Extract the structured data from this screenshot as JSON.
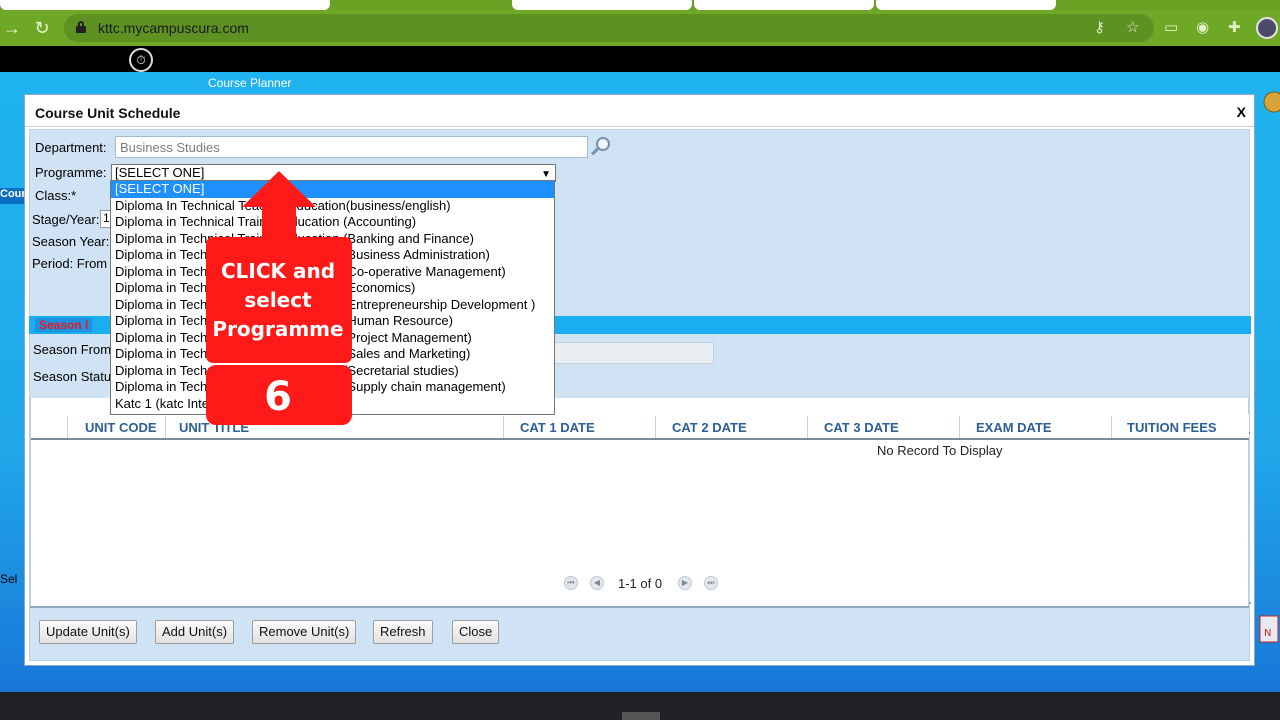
{
  "browser": {
    "url": "kttc.mycampuscura.com"
  },
  "page": {
    "title": "Course Planner",
    "left_label": "Cour",
    "left_select_text": "Sel"
  },
  "modal": {
    "title": "Course Unit Schedule",
    "close_label": "X",
    "department": {
      "label": "Department:",
      "value": "Business Studies"
    },
    "programme": {
      "label": "Programme:",
      "selected": "[SELECT ONE]",
      "options": [
        "[SELECT ONE]",
        "Diploma In Technical Teacher Education(business/english)",
        "Diploma in Technical Trainer Education (Accounting)",
        "Diploma in Technical Trainer Education (Banking and Finance)",
        "Diploma in Technical Trainer Education (Business Administration)",
        "Diploma in Technical Trainer Education (Co-operative Management)",
        "Diploma in Technical Trainer Education (Economics)",
        "Diploma in Technical Trainer Education (Entrepreneurship Development )",
        "Diploma in Technical Trainer Education (Human Resource)",
        "Diploma in Technical Trainer Education (Project Management)",
        "Diploma in Technical Trainer Education (Sales and Marketing)",
        "Diploma in Technical Trainer Education (Secretarial studies)",
        "Diploma in Technical Trainer Education (Supply chain management)",
        "Katc 1 (katc Intern)"
      ]
    },
    "class_label": "Class:*",
    "stage_label": "Stage/Year:",
    "stage_value": "1",
    "season_year_label": "Season Year:",
    "period_label": "Period: From",
    "season_tab": "Season I",
    "season_from_label": "Season From",
    "season_status_label": "Season Status",
    "grid": {
      "columns": [
        "UNIT CODE",
        "UNIT TITLE",
        "CAT 1 DATE",
        "CAT 2 DATE",
        "CAT 3 DATE",
        "EXAM DATE",
        "TUITION FEES"
      ],
      "empty_text": "No Record To Display",
      "pager_text": "1-1 of 0"
    },
    "buttons": {
      "update": "Update Unit(s)",
      "add": "Add Unit(s)",
      "remove": "Remove Unit(s)",
      "refresh": "Refresh",
      "close": "Close"
    }
  },
  "annotation": {
    "text_line1": "CLICK and",
    "text_line2": "select",
    "text_line3": "Programme",
    "step_number": "6",
    "color": "#ff1a1a"
  },
  "icons": {
    "search": "search-icon",
    "clock": "clock-icon"
  }
}
